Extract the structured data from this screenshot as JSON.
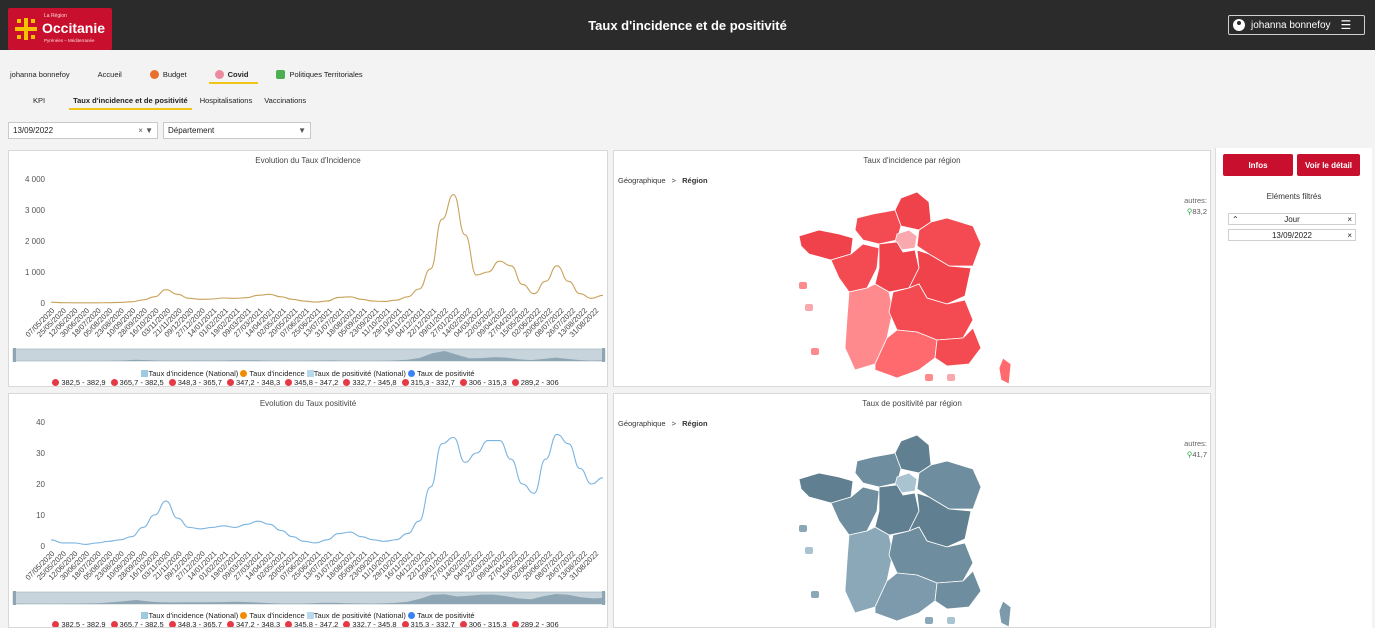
{
  "header": {
    "logo": {
      "small": "La Région",
      "name": "Occitanie",
      "sub": "Pyrénées – Méditerranée"
    },
    "title": "Taux d'incidence et de positivité",
    "user": "johanna bonnefoy",
    "user_icon": "user-circle-icon",
    "menu_icon": "hamburger-icon"
  },
  "nav": {
    "user_label": "johanna bonnefoy",
    "items": [
      {
        "label": "Accueil",
        "icon": "",
        "color": ""
      },
      {
        "label": "Budget",
        "icon": "budget-icon",
        "color": "#e8702a"
      },
      {
        "label": "Covid",
        "icon": "covid-icon",
        "color": "#e84d6a"
      },
      {
        "label": "Politiques Territoriales",
        "icon": "leaf-icon",
        "color": "#4caf50"
      }
    ],
    "active": "Covid"
  },
  "subnav": {
    "items": [
      "KPI",
      "Taux d'incidence et de positivité",
      "Hospitalisations",
      "Vaccinations"
    ],
    "active": "Taux d'incidence et de positivité"
  },
  "filters": {
    "date": "13/09/2022",
    "date_controls": "× ▼",
    "departement": "Département",
    "dep_control": "▼"
  },
  "panels": {
    "incidence_title": "Evolution du Taux d'Incidence",
    "positivite_title": "Evolution du Taux positivité",
    "map_incidence_title": "Taux d'incidence par région",
    "map_positivite_title": "Taux de positivité par région",
    "crumb_root": "Géographique",
    "crumb_sep": ">",
    "crumb_level": "Région",
    "autres_label": "autres:",
    "autres_incidence": "83,2",
    "autres_positivite": "41,7"
  },
  "legend": {
    "series": [
      {
        "label": "Taux d'incidence (National)",
        "color": "#9ecae1",
        "shape": "square"
      },
      {
        "label": "Taux d'incidence",
        "color": "#f08c00",
        "shape": "circle"
      },
      {
        "label": "Taux de positivité (National)",
        "color": "#b8d8ee",
        "shape": "square"
      },
      {
        "label": "Taux de positivité",
        "color": "#3b82f6",
        "shape": "circle"
      }
    ],
    "ranges": [
      "382,5 - 382,9",
      "365,7 - 382,5",
      "348,3 - 365,7",
      "347,2 - 348,3",
      "345,8 - 347,2",
      "332,7 - 345,8",
      "315,3 - 332,7",
      "306 - 315,3",
      "289,2 - 306"
    ],
    "range_color": "#e53945"
  },
  "sidebar": {
    "infos_label": "Infos",
    "detail_label": "Voir le détail",
    "filtered_title": "Eléments filtrés",
    "filter_name": "Jour",
    "filter_value": "13/09/2022"
  },
  "chart_data": [
    {
      "type": "line",
      "title": "Evolution du Taux d'Incidence",
      "ylim": [
        0,
        4000
      ],
      "yticks": [
        "0",
        "1 000",
        "2 000",
        "3 000",
        "4 000"
      ],
      "xticks": [
        "07/05/2020",
        "25/05/2020",
        "12/06/2020",
        "30/06/2020",
        "18/07/2020",
        "05/08/2020",
        "23/08/2020",
        "10/09/2020",
        "28/09/2020",
        "16/10/2020",
        "03/11/2020",
        "21/11/2020",
        "09/12/2020",
        "27/12/2020",
        "14/01/2021",
        "01/02/2021",
        "19/02/2021",
        "09/03/2021",
        "27/03/2021",
        "14/04/2021",
        "02/05/2021",
        "20/05/2021",
        "07/06/2021",
        "25/06/2021",
        "13/07/2021",
        "31/07/2021",
        "18/08/2021",
        "05/09/2021",
        "23/09/2021",
        "11/10/2021",
        "29/10/2021",
        "16/11/2021",
        "04/12/2021",
        "22/12/2021",
        "09/01/2022",
        "27/01/2022",
        "14/02/2022",
        "04/03/2022",
        "22/03/2022",
        "09/04/2022",
        "27/04/2022",
        "15/05/2022",
        "02/06/2022",
        "20/06/2022",
        "08/07/2022",
        "26/07/2022",
        "13/08/2022",
        "31/08/2022"
      ],
      "series": [
        {
          "name": "Taux d'incidence",
          "color": "#c8a25a",
          "values": [
            25,
            10,
            5,
            5,
            8,
            10,
            20,
            40,
            100,
            200,
            430,
            280,
            150,
            120,
            130,
            160,
            150,
            170,
            250,
            280,
            200,
            120,
            60,
            30,
            60,
            180,
            200,
            120,
            60,
            50,
            90,
            200,
            450,
            1100,
            2700,
            3500,
            2200,
            900,
            1000,
            1350,
            1200,
            600,
            300,
            700,
            1200,
            700,
            300,
            150,
            250
          ]
        }
      ]
    },
    {
      "type": "line",
      "title": "Evolution du Taux positivité",
      "ylim": [
        0,
        40
      ],
      "yticks": [
        "0",
        "10",
        "20",
        "30",
        "40"
      ],
      "xticks": [
        "07/05/2020",
        "25/05/2020",
        "12/06/2020",
        "30/06/2020",
        "18/07/2020",
        "05/08/2020",
        "23/08/2020",
        "10/09/2020",
        "28/09/2020",
        "16/10/2020",
        "03/11/2020",
        "21/11/2020",
        "09/12/2020",
        "27/12/2020",
        "14/01/2021",
        "01/02/2021",
        "19/02/2021",
        "09/03/2021",
        "27/03/2021",
        "14/04/2021",
        "02/05/2021",
        "20/05/2021",
        "07/06/2021",
        "25/06/2021",
        "13/07/2021",
        "31/07/2021",
        "18/08/2021",
        "05/09/2021",
        "23/09/2021",
        "11/10/2021",
        "29/10/2021",
        "16/11/2021",
        "04/12/2021",
        "22/12/2021",
        "09/01/2022",
        "27/01/2022",
        "14/02/2022",
        "04/03/2022",
        "22/03/2022",
        "09/04/2022",
        "27/04/2022",
        "15/05/2022",
        "02/06/2022",
        "20/06/2022",
        "08/07/2022",
        "26/07/2022",
        "13/08/2022",
        "31/08/2022"
      ],
      "series": [
        {
          "name": "Taux de positivité",
          "color": "#7ab4e0",
          "values": [
            2,
            1,
            1,
            0.5,
            1,
            1.5,
            2,
            3,
            6,
            10,
            14.5,
            9,
            6,
            5.5,
            6,
            6.5,
            6,
            7,
            8,
            7,
            5,
            3,
            1.5,
            1,
            2,
            4,
            4.5,
            3,
            2,
            1.5,
            2,
            4,
            8,
            19,
            33,
            35,
            27,
            30,
            34,
            34,
            28,
            20,
            17,
            28,
            36,
            33,
            25,
            20,
            22
          ]
        }
      ]
    }
  ],
  "maps": {
    "incidence": {
      "main_color": "#f0424a",
      "colors": [
        "#f0424a",
        "#f44b52",
        "#ff6a6f",
        "#ff8a8d",
        "#f9a9ad",
        "#e8e8e8"
      ]
    },
    "positivite": {
      "main_color": "#607f90",
      "colors": [
        "#607f90",
        "#6e8d9e",
        "#7c9aab",
        "#8aa8b8",
        "#a9c3d0",
        "#e8e8e8"
      ]
    }
  }
}
